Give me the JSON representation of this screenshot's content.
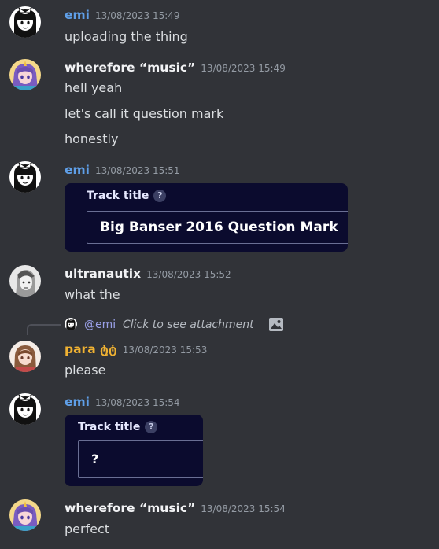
{
  "colors": {
    "background": "#313338",
    "emi": "#5f9fe8",
    "default_name": "#f2f3f5",
    "para": "#f0b232"
  },
  "messages": [
    {
      "author": "emi",
      "timestamp": "13/08/2023 15:49",
      "lines": [
        "uploading the thing"
      ],
      "avatar_icon": "emi-avatar-icon"
    },
    {
      "author": "wherefore “music”",
      "timestamp": "13/08/2023 15:49",
      "lines": [
        "hell yeah",
        "let's call it question mark",
        "honestly"
      ],
      "avatar_icon": "wherefore-avatar-icon"
    },
    {
      "author": "emi",
      "timestamp": "13/08/2023 15:51",
      "embed": {
        "label": "Track title",
        "help": "?",
        "value": "Big Banser 2016 Question Mark"
      },
      "avatar_icon": "emi-avatar-icon"
    },
    {
      "author": "ultranautix",
      "timestamp": "13/08/2023 15:52",
      "lines": [
        "what the"
      ],
      "avatar_icon": "ultranautix-avatar-icon"
    },
    {
      "author": "para ტ̫ტ",
      "timestamp": "13/08/2023 15:53",
      "lines": [
        "please"
      ],
      "avatar_icon": "para-avatar-icon",
      "reply": {
        "mention": "@emi",
        "text": "Click to see attachment",
        "icon": "image-icon"
      }
    },
    {
      "author": "emi",
      "timestamp": "13/08/2023 15:54",
      "embed": {
        "label": "Track title",
        "help": "?",
        "value": "?"
      },
      "avatar_icon": "emi-avatar-icon"
    },
    {
      "author": "wherefore “music”",
      "timestamp": "13/08/2023 15:54",
      "lines": [
        "perfect"
      ],
      "avatar_icon": "wherefore-avatar-icon"
    }
  ]
}
